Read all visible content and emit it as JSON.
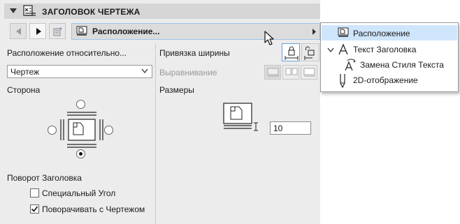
{
  "header": {
    "title": "ЗАГОЛОВОК ЧЕРТЕЖА",
    "icon": "drawing-title-icon"
  },
  "toolbar": {
    "breadcrumb_label": "Расположение..."
  },
  "left": {
    "position_relative_label": "Расположение относительно...",
    "position_relative_value": "Чертеж",
    "side_label": "Сторона",
    "rotation_label": "Поворот Заголовка",
    "special_angle_label": "Специальный Угол",
    "special_angle_checked": false,
    "rotate_with_drawing_label": "Поворачивать с Чертежом",
    "rotate_with_drawing_checked": true,
    "side_selected": "bottom"
  },
  "right": {
    "width_binding_label": "Привязка ширины",
    "alignment_label": "Выравнивание",
    "sizes_label": "Размеры",
    "size_value": "10"
  },
  "popup_menu": {
    "items": [
      {
        "label": "Расположение",
        "icon": "layout-icon",
        "selected": true
      },
      {
        "label": "Текст Заголовка",
        "icon": "text-a-icon",
        "expanded": true
      },
      {
        "label": "Замена Стиля Текста",
        "icon": "text-style-replace-icon"
      },
      {
        "label": "2D-отображение",
        "icon": "pen-icon"
      }
    ]
  },
  "colors": {
    "panel_bg": "#ececec",
    "header_bg": "#d6d6d6",
    "selection": "#cfe5fb",
    "accent_border": "#9ec4e6"
  }
}
